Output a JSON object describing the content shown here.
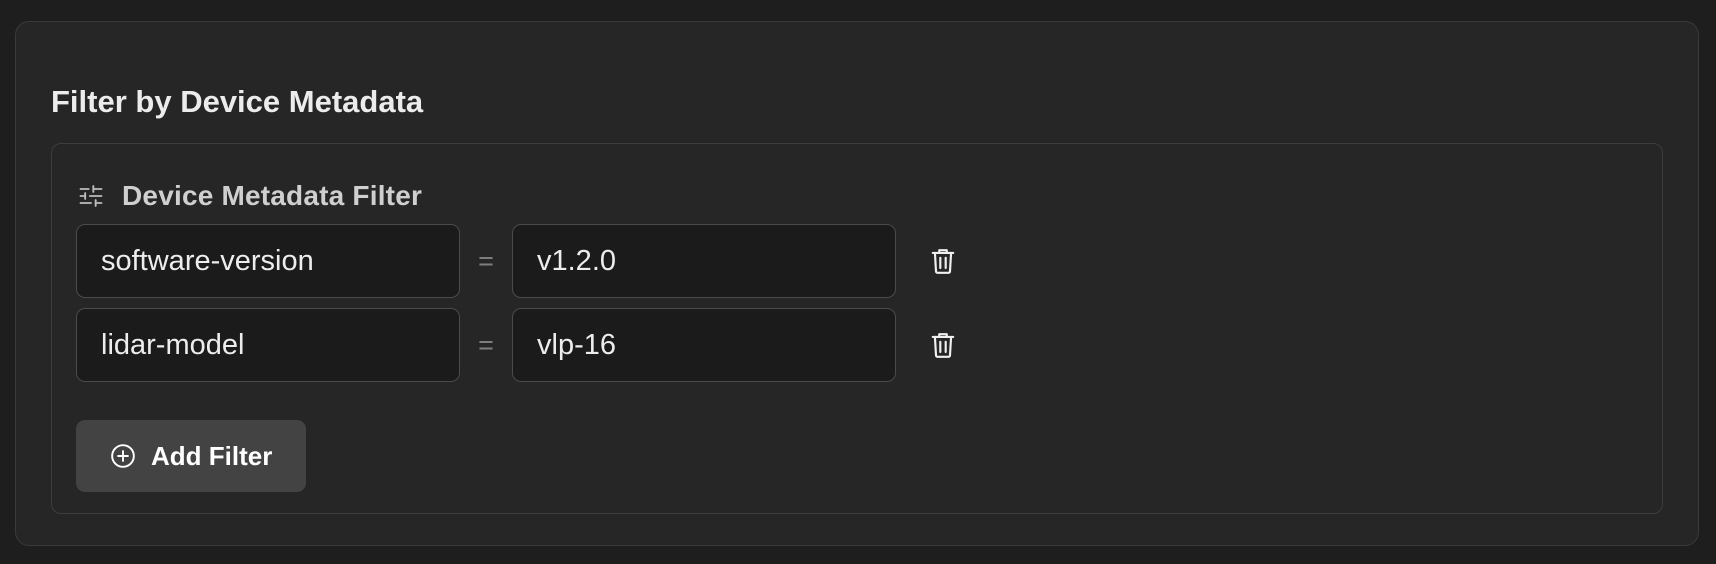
{
  "panel": {
    "title": "Filter by Device Metadata"
  },
  "filter_group": {
    "title": "Device Metadata Filter",
    "header_icon": "tune-sliders-icon",
    "rows": [
      {
        "key": "software-version",
        "operator": "=",
        "value": "v1.2.0",
        "delete_icon": "trash-icon"
      },
      {
        "key": "lidar-model",
        "operator": "=",
        "value": "vlp-16",
        "delete_icon": "trash-icon"
      }
    ],
    "add_button": {
      "label": "Add Filter",
      "icon": "add-circle-icon"
    }
  },
  "colors": {
    "page_background": "#1e1e1e",
    "card_background": "#262626",
    "input_background": "#1b1b1b",
    "button_background": "#434343",
    "border": "#3a3a3a",
    "text": "#ececec",
    "muted": "#7d7d7d"
  }
}
